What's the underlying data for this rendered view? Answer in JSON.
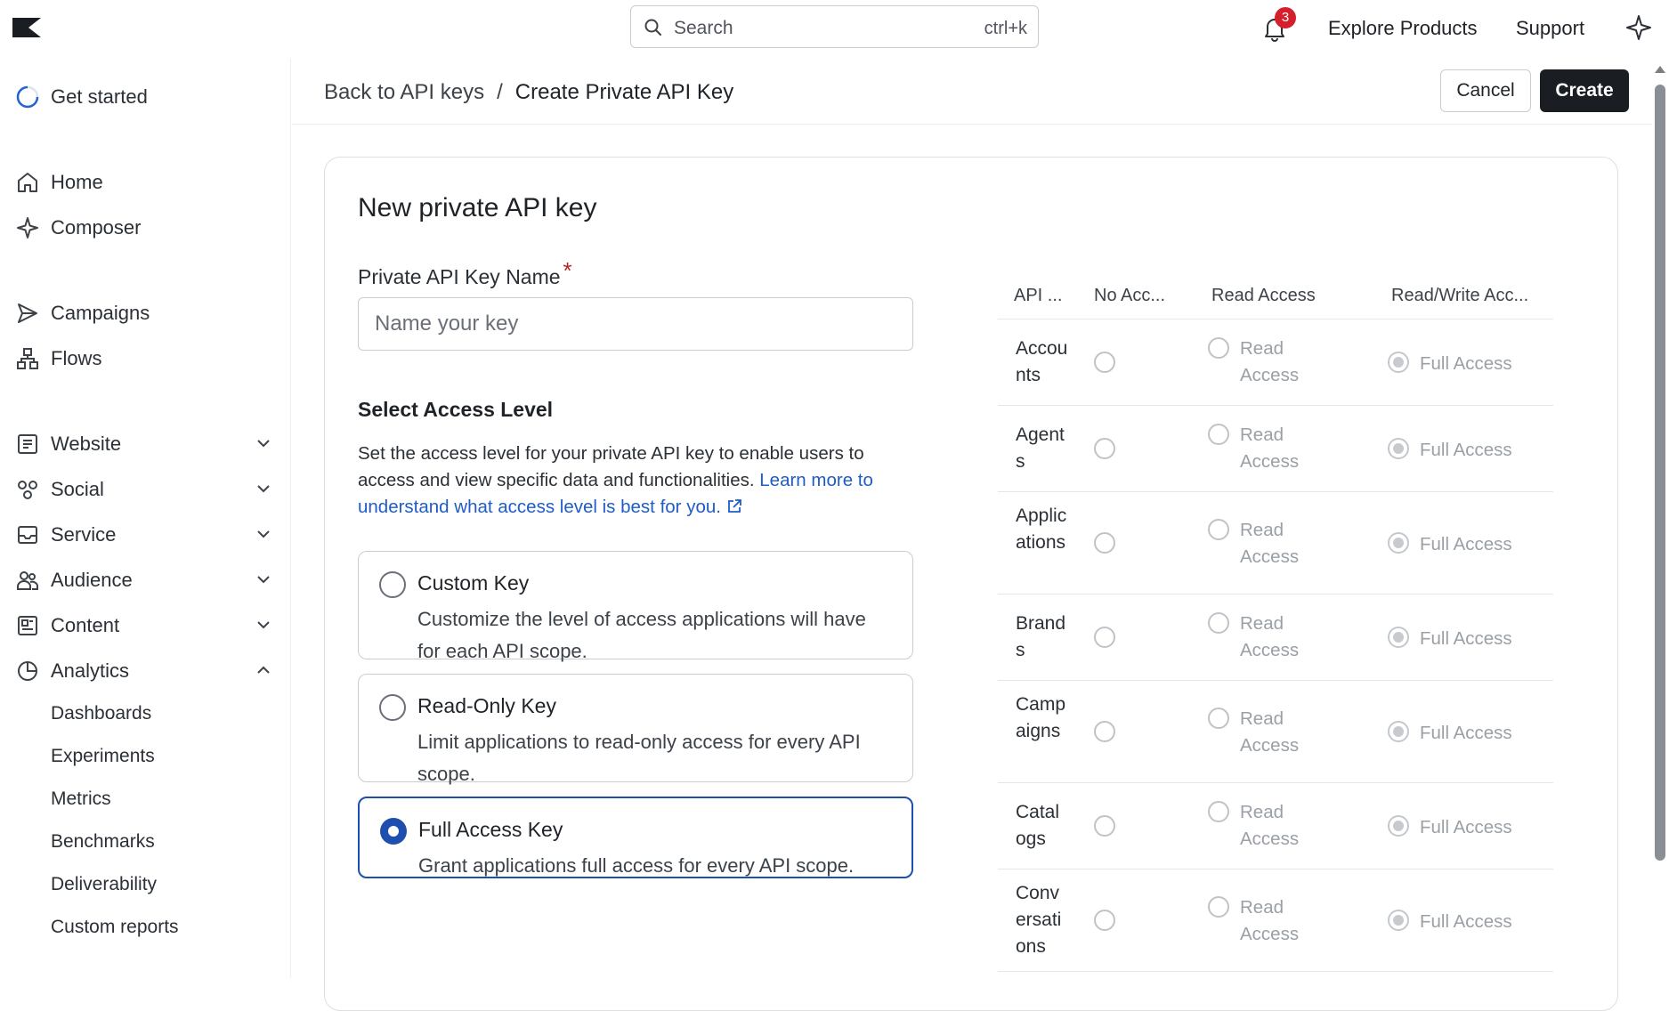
{
  "topbar": {
    "search_placeholder": "Search",
    "search_shortcut": "ctrl+k",
    "notification_count": "3",
    "explore_label": "Explore Products",
    "support_label": "Support"
  },
  "sidebar": {
    "get_started": "Get started",
    "items": [
      {
        "label": "Home",
        "icon": "home-icon"
      },
      {
        "label": "Composer",
        "icon": "sparkle-icon"
      },
      {
        "label": "Campaigns",
        "icon": "send-icon"
      },
      {
        "label": "Flows",
        "icon": "flows-icon"
      },
      {
        "label": "Website",
        "icon": "website-icon"
      },
      {
        "label": "Social",
        "icon": "social-icon"
      },
      {
        "label": "Service",
        "icon": "inbox-icon"
      },
      {
        "label": "Audience",
        "icon": "people-icon"
      },
      {
        "label": "Content",
        "icon": "content-icon"
      },
      {
        "label": "Analytics",
        "icon": "pie-chart-icon"
      }
    ],
    "analytics_sub": [
      "Dashboards",
      "Experiments",
      "Metrics",
      "Benchmarks",
      "Deliverability",
      "Custom reports"
    ]
  },
  "header": {
    "back_label": "Back to API keys",
    "separator": "/",
    "current": "Create Private API Key",
    "cancel_label": "Cancel",
    "create_label": "Create"
  },
  "form": {
    "title": "New private API key",
    "name_label": "Private API Key Name",
    "required_mark": "*",
    "name_placeholder": "Name your key",
    "name_value": "",
    "access_title": "Select Access Level",
    "access_desc": "Set the access level for your private API key to enable users to access and view specific data and functionalities. ",
    "access_link": "Learn more to understand what access level is best for you.",
    "options": [
      {
        "title": "Custom Key",
        "desc": "Customize the level of access applications will have for each API scope.",
        "selected": false
      },
      {
        "title": "Read-Only Key",
        "desc": "Limit applications to read-only access for every API scope.",
        "selected": false
      },
      {
        "title": "Full Access Key",
        "desc": "Grant applications full access for every API scope.",
        "selected": true
      }
    ]
  },
  "scopes": {
    "headers": [
      "API ...",
      "No Acc...",
      "Read Access",
      "Read/Write Acc..."
    ],
    "read_label": "Read Access",
    "full_label": "Full Access",
    "rows": [
      {
        "name": "Accounts",
        "selected": "full"
      },
      {
        "name": "Agents",
        "selected": "full"
      },
      {
        "name": "Applications",
        "selected": "full"
      },
      {
        "name": "Brands",
        "selected": "full"
      },
      {
        "name": "Campaigns",
        "selected": "full"
      },
      {
        "name": "Catalogs",
        "selected": "full"
      },
      {
        "name": "Conversations",
        "selected": "full"
      }
    ]
  },
  "colors": {
    "primary_blue": "#1f4fae",
    "link_blue": "#1f5cc7",
    "create_button": "#1a1d21",
    "badge_red": "#d4202c"
  }
}
